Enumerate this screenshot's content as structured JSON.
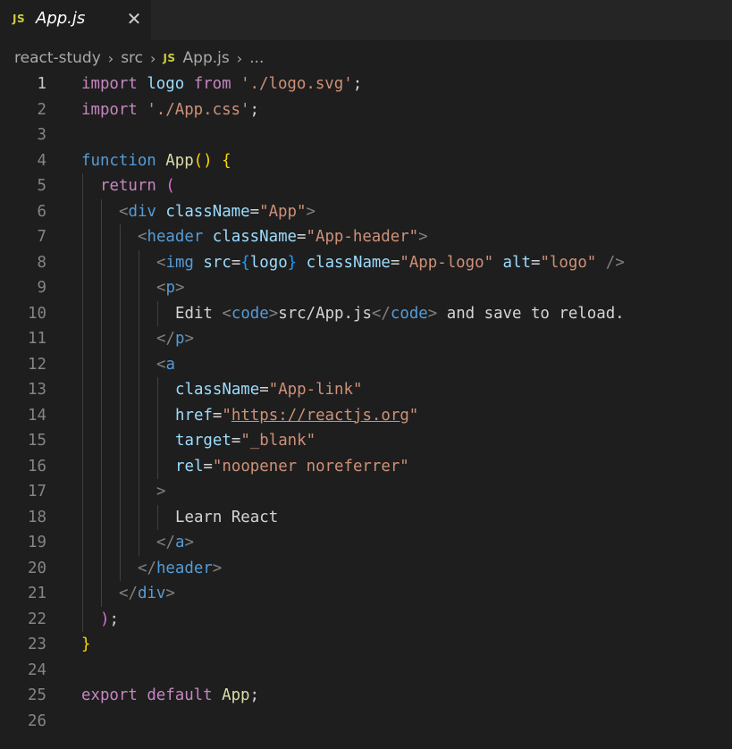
{
  "tab": {
    "badge": "JS",
    "name": "App.js",
    "close": "✕"
  },
  "breadcrumb": {
    "items": [
      "react-study",
      "src",
      "App.js",
      "..."
    ],
    "separator": "›",
    "badge": "JS"
  },
  "colors": {
    "background": "#1e1e1e",
    "keyword": "#c586c0",
    "string": "#ce9178",
    "function": "#dcdcaa",
    "tag": "#569cd6",
    "attribute": "#9cdcfe"
  },
  "editor": {
    "active_line": 1,
    "lines": [
      {
        "n": "1",
        "indent": 0,
        "tokens": [
          [
            "kw",
            "import"
          ],
          [
            "tx",
            " "
          ],
          [
            "id",
            "logo"
          ],
          [
            "tx",
            " "
          ],
          [
            "kw",
            "from"
          ],
          [
            "tx",
            " "
          ],
          [
            "st",
            "'./logo.svg'"
          ],
          [
            "tx",
            ";"
          ]
        ]
      },
      {
        "n": "2",
        "indent": 0,
        "tokens": [
          [
            "kw",
            "import"
          ],
          [
            "tx",
            " "
          ],
          [
            "st",
            "'./App.css'"
          ],
          [
            "tx",
            ";"
          ]
        ]
      },
      {
        "n": "3",
        "indent": 0,
        "tokens": []
      },
      {
        "n": "4",
        "indent": 0,
        "tokens": [
          [
            "sk",
            "function"
          ],
          [
            "tx",
            " "
          ],
          [
            "fn",
            "App"
          ],
          [
            "b1",
            "()"
          ],
          [
            "tx",
            " "
          ],
          [
            "b1",
            "{"
          ]
        ]
      },
      {
        "n": "5",
        "indent": 1,
        "tokens": [
          [
            "kw",
            "return"
          ],
          [
            "tx",
            " "
          ],
          [
            "b2",
            "("
          ]
        ]
      },
      {
        "n": "6",
        "indent": 2,
        "tokens": [
          [
            "br",
            "<"
          ],
          [
            "tag",
            "div"
          ],
          [
            "tx",
            " "
          ],
          [
            "at",
            "className"
          ],
          [
            "tx",
            "="
          ],
          [
            "st",
            "\"App\""
          ],
          [
            "br",
            ">"
          ]
        ]
      },
      {
        "n": "7",
        "indent": 3,
        "tokens": [
          [
            "br",
            "<"
          ],
          [
            "tag",
            "header"
          ],
          [
            "tx",
            " "
          ],
          [
            "at",
            "className"
          ],
          [
            "tx",
            "="
          ],
          [
            "st",
            "\"App-header\""
          ],
          [
            "br",
            ">"
          ]
        ]
      },
      {
        "n": "8",
        "indent": 4,
        "tokens": [
          [
            "br",
            "<"
          ],
          [
            "tag",
            "img"
          ],
          [
            "tx",
            " "
          ],
          [
            "at",
            "src"
          ],
          [
            "tx",
            "="
          ],
          [
            "b3",
            "{"
          ],
          [
            "id",
            "logo"
          ],
          [
            "b3",
            "}"
          ],
          [
            "tx",
            " "
          ],
          [
            "at",
            "className"
          ],
          [
            "tx",
            "="
          ],
          [
            "st",
            "\"App-logo\""
          ],
          [
            "tx",
            " "
          ],
          [
            "at",
            "alt"
          ],
          [
            "tx",
            "="
          ],
          [
            "st",
            "\"logo\""
          ],
          [
            "tx",
            " "
          ],
          [
            "br",
            "/>"
          ]
        ]
      },
      {
        "n": "9",
        "indent": 4,
        "tokens": [
          [
            "br",
            "<"
          ],
          [
            "tag",
            "p"
          ],
          [
            "br",
            ">"
          ]
        ]
      },
      {
        "n": "10",
        "indent": 5,
        "tokens": [
          [
            "tx",
            "Edit "
          ],
          [
            "br",
            "<"
          ],
          [
            "tag",
            "code"
          ],
          [
            "br",
            ">"
          ],
          [
            "tx",
            "src/App.js"
          ],
          [
            "br",
            "</"
          ],
          [
            "tag",
            "code"
          ],
          [
            "br",
            ">"
          ],
          [
            "tx",
            " and save to reload."
          ]
        ]
      },
      {
        "n": "11",
        "indent": 4,
        "tokens": [
          [
            "br",
            "</"
          ],
          [
            "tag",
            "p"
          ],
          [
            "br",
            ">"
          ]
        ]
      },
      {
        "n": "12",
        "indent": 4,
        "tokens": [
          [
            "br",
            "<"
          ],
          [
            "tag",
            "a"
          ]
        ]
      },
      {
        "n": "13",
        "indent": 5,
        "tokens": [
          [
            "at",
            "className"
          ],
          [
            "tx",
            "="
          ],
          [
            "st",
            "\"App-link\""
          ]
        ]
      },
      {
        "n": "14",
        "indent": 5,
        "tokens": [
          [
            "at",
            "href"
          ],
          [
            "tx",
            "="
          ],
          [
            "st",
            "\""
          ],
          [
            "url",
            "https://reactjs.org"
          ],
          [
            "st",
            "\""
          ]
        ]
      },
      {
        "n": "15",
        "indent": 5,
        "tokens": [
          [
            "at",
            "target"
          ],
          [
            "tx",
            "="
          ],
          [
            "st",
            "\"_blank\""
          ]
        ]
      },
      {
        "n": "16",
        "indent": 5,
        "tokens": [
          [
            "at",
            "rel"
          ],
          [
            "tx",
            "="
          ],
          [
            "st",
            "\"noopener noreferrer\""
          ]
        ]
      },
      {
        "n": "17",
        "indent": 4,
        "tokens": [
          [
            "br",
            ">"
          ]
        ]
      },
      {
        "n": "18",
        "indent": 5,
        "tokens": [
          [
            "tx",
            "Learn React"
          ]
        ]
      },
      {
        "n": "19",
        "indent": 4,
        "tokens": [
          [
            "br",
            "</"
          ],
          [
            "tag",
            "a"
          ],
          [
            "br",
            ">"
          ]
        ]
      },
      {
        "n": "20",
        "indent": 3,
        "tokens": [
          [
            "br",
            "</"
          ],
          [
            "tag",
            "header"
          ],
          [
            "br",
            ">"
          ]
        ]
      },
      {
        "n": "21",
        "indent": 2,
        "tokens": [
          [
            "br",
            "</"
          ],
          [
            "tag",
            "div"
          ],
          [
            "br",
            ">"
          ]
        ]
      },
      {
        "n": "22",
        "indent": 1,
        "tokens": [
          [
            "b2",
            ")"
          ],
          [
            "tx",
            ";"
          ]
        ]
      },
      {
        "n": "23",
        "indent": 0,
        "tokens": [
          [
            "b1",
            "}"
          ]
        ]
      },
      {
        "n": "24",
        "indent": 0,
        "tokens": []
      },
      {
        "n": "25",
        "indent": 0,
        "tokens": [
          [
            "kw",
            "export"
          ],
          [
            "tx",
            " "
          ],
          [
            "kw",
            "default"
          ],
          [
            "tx",
            " "
          ],
          [
            "fn",
            "App"
          ],
          [
            "tx",
            ";"
          ]
        ]
      },
      {
        "n": "26",
        "indent": 0,
        "tokens": []
      }
    ]
  }
}
